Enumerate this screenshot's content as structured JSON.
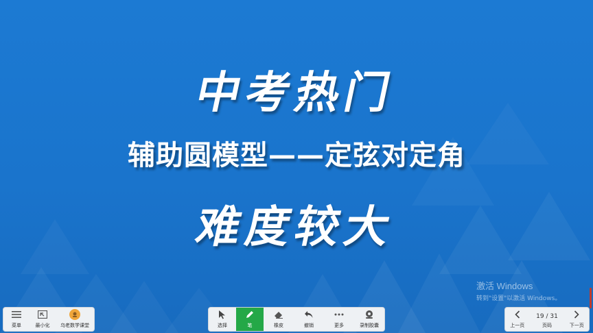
{
  "slide": {
    "title_main": "中考热门",
    "title_sub": "辅助圆模型——定弦对定角",
    "title_difficulty": "难度较大"
  },
  "watermark": {
    "line1": "激活 Windows",
    "line2": "转到\"设置\"以激活 Windows。"
  },
  "left_toolbar": {
    "menu_label": "菜单",
    "minimize_label": "最小化",
    "account_label": "乌老数学课堂"
  },
  "center_toolbar": {
    "select_label": "选择",
    "pen_label": "笔",
    "eraser_label": "橡皮",
    "undo_label": "撤销",
    "more_label": "更多",
    "record_label": "录制胶囊"
  },
  "right_toolbar": {
    "prev_label": "上一页",
    "page_label": "页码",
    "page_counter": "19 / 31",
    "next_label": "下一页"
  },
  "colors": {
    "background": "#1a74cc",
    "active_tool": "#24a847",
    "toolbar_bg": "#eef1f4"
  },
  "icons": [
    "menu-icon",
    "minimize-icon",
    "avatar-icon",
    "cursor-icon",
    "pen-icon",
    "eraser-icon",
    "undo-icon",
    "more-icon",
    "record-icon",
    "chevron-left-icon",
    "chevron-right-icon"
  ]
}
